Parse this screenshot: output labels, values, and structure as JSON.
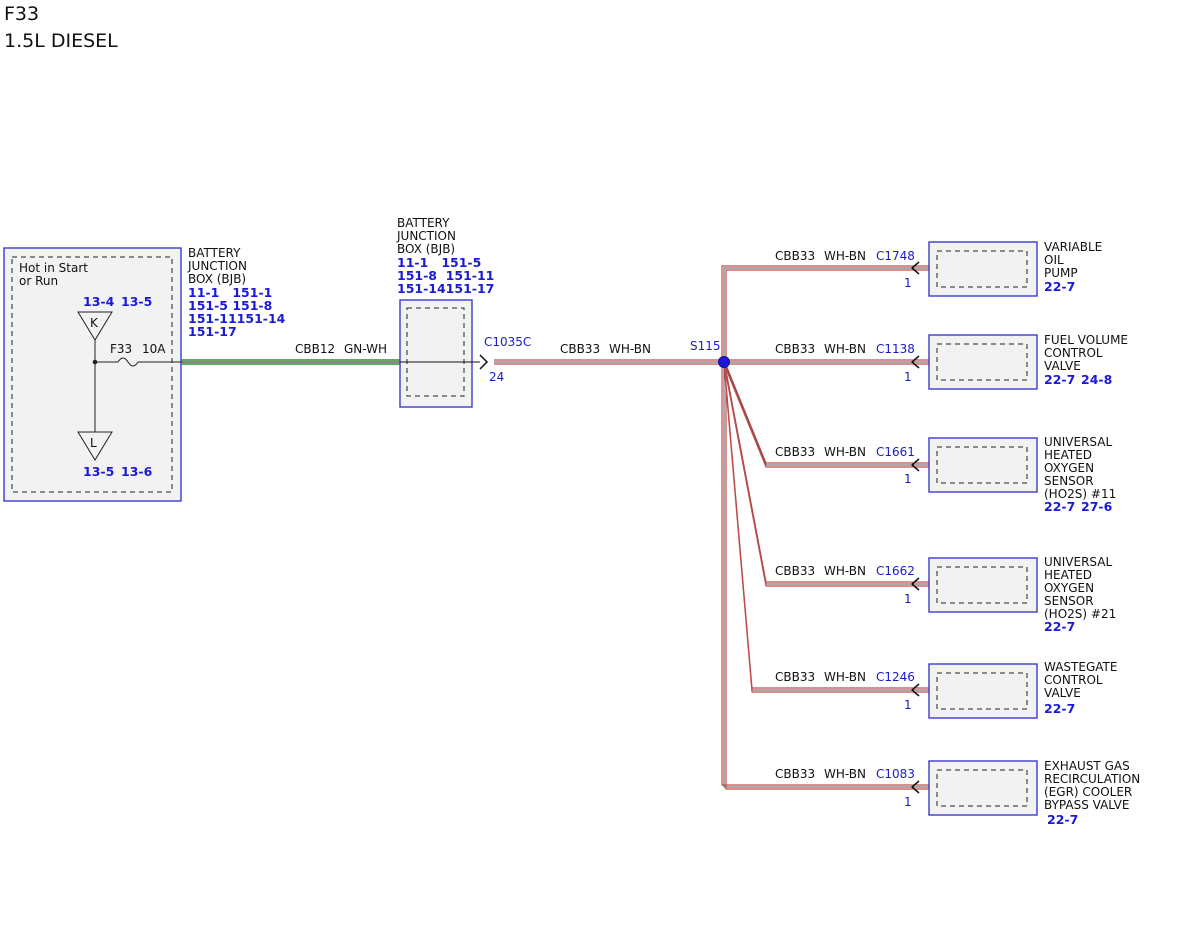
{
  "title": {
    "line1": "F33",
    "line2": "1.5L DIESEL"
  },
  "source_box": {
    "label_lines": [
      "Hot in Start",
      "or Run"
    ],
    "refs_top": [
      "13-4",
      "13-5"
    ],
    "refs_bottom": [
      "13-5",
      "13-6"
    ],
    "relay_top": "K",
    "relay_bottom": "L",
    "fuse": "F33",
    "rating": "10A"
  },
  "bjb_left": {
    "name_lines": [
      "BATTERY",
      "JUNCTION",
      "BOX (BJB)"
    ],
    "ref_lines": [
      "11-1   151-1",
      "151-5 151-8",
      "151-11151-14",
      "151-17"
    ]
  },
  "wire_a": {
    "circuit": "CBB12",
    "color": "GN-WH"
  },
  "bjb_mid": {
    "name_lines": [
      "BATTERY",
      "JUNCTION",
      "BOX (BJB)"
    ],
    "ref_lines": [
      "11-1   151-5",
      "151-8  151-11",
      "151-14151-17"
    ],
    "connector": "C1035C",
    "pin": "24"
  },
  "wire_b": {
    "circuit": "CBB33",
    "color": "WH-BN"
  },
  "splice": "S115",
  "branches": [
    {
      "circuit": "CBB33",
      "color": "WH-BN",
      "connector": "C1748",
      "pin": "1",
      "name_lines": [
        "VARIABLE",
        "OIL",
        "PUMP"
      ],
      "refs": [
        "22-7"
      ]
    },
    {
      "circuit": "CBB33",
      "color": "WH-BN",
      "connector": "C1138",
      "pin": "1",
      "name_lines": [
        "FUEL VOLUME",
        "CONTROL",
        "VALVE"
      ],
      "refs": [
        "22-7",
        "24-8"
      ]
    },
    {
      "circuit": "CBB33",
      "color": "WH-BN",
      "connector": "C1661",
      "pin": "1",
      "name_lines": [
        "UNIVERSAL",
        "HEATED",
        "OXYGEN",
        "SENSOR",
        "(HO2S) #11"
      ],
      "refs": [
        "22-7",
        "27-6"
      ]
    },
    {
      "circuit": "CBB33",
      "color": "WH-BN",
      "connector": "C1662",
      "pin": "1",
      "name_lines": [
        "UNIVERSAL",
        "HEATED",
        "OXYGEN",
        "SENSOR",
        "(HO2S) #21"
      ],
      "refs": [
        "22-7"
      ]
    },
    {
      "circuit": "CBB33",
      "color": "WH-BN",
      "connector": "C1246",
      "pin": "1",
      "name_lines": [
        "WASTEGATE",
        "CONTROL",
        "VALVE"
      ],
      "refs": [
        "22-7"
      ]
    },
    {
      "circuit": "CBB33",
      "color": "WH-BN",
      "connector": "C1083",
      "pin": "1",
      "name_lines": [
        "EXHAUST GAS",
        "RECIRCULATION",
        "(EGR) COOLER",
        "BYPASS VALVE"
      ],
      "refs": [
        "22-7"
      ]
    }
  ],
  "colors": {
    "box_border": "#3b3bd0",
    "box_fill": "#f2f2f2",
    "wire_green": "#2f8a2f",
    "wire_red": "#c84a4a",
    "text_blue": "#1a1ad8"
  }
}
